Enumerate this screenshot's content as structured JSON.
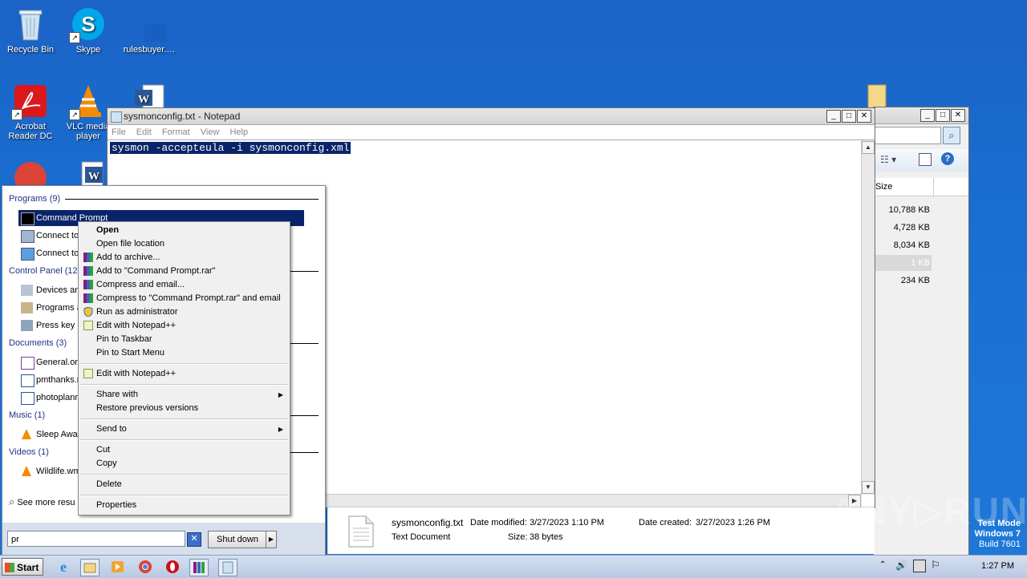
{
  "desktop_icons": [
    {
      "label": "Recycle Bin",
      "icon": "recycle-bin-icon"
    },
    {
      "label": "Skype",
      "icon": "skype-icon"
    },
    {
      "label": "rulesbuyer.…",
      "icon": "blank-file-icon"
    },
    {
      "label": "Acrobat Reader DC",
      "icon": "acrobat-icon"
    },
    {
      "label": "VLC media player",
      "icon": "vlc-icon"
    },
    {
      "label": "",
      "icon": "word-doc-icon"
    },
    {
      "label": "",
      "icon": "chrome-icon"
    },
    {
      "label": "",
      "icon": "word-doc-icon"
    },
    {
      "label": "",
      "icon": "folder-icon"
    }
  ],
  "notepad": {
    "title": "sysmonconfig.txt - Notepad",
    "menu": [
      "File",
      "Edit",
      "Format",
      "View",
      "Help"
    ],
    "content": "sysmon -accepteula -i sysmonconfig.xml",
    "buttons": {
      "minimize": "_",
      "maximize": "□",
      "close": "✕"
    }
  },
  "explorer": {
    "column_header": "Size",
    "sizes": [
      "10,788 KB",
      "4,728 KB",
      "8,034 KB",
      "1 KB",
      "234 KB"
    ],
    "buttons": {
      "minimize": "_",
      "maximize": "□",
      "close": "✕"
    },
    "details": {
      "name": "sysmonconfig.txt",
      "type": "Text Document",
      "modified_label": "Date modified:",
      "modified": "3/27/2023 1:10 PM",
      "created_label": "Date created:",
      "created": "3/27/2023 1:26 PM",
      "size_label": "Size:",
      "size": "38 bytes"
    }
  },
  "start_menu": {
    "groups": {
      "programs": "Programs (9)",
      "control_panel": "Control Panel (128)",
      "documents": "Documents (3)",
      "music": "Music (1)",
      "videos": "Videos (1)"
    },
    "programs": [
      "Command Prompt",
      "Connect to",
      "Connect to"
    ],
    "control_panel": [
      "Devices and",
      "Programs a",
      "Press key c"
    ],
    "documents": [
      "General.on",
      "pmthanks.r",
      "photoplann"
    ],
    "music": [
      "Sleep Away"
    ],
    "videos": [
      "Wildlife.wm"
    ],
    "see_more": "See more resu",
    "search_value": "pr",
    "clear": "✕",
    "shutdown": "Shut down",
    "shutdown_arrow": "▶"
  },
  "context_menu": {
    "items": [
      {
        "label": "Open",
        "bold": true
      },
      {
        "label": "Open file location"
      },
      {
        "label": "Add to archive...",
        "icon": "winrar-icon"
      },
      {
        "label": "Add to \"Command Prompt.rar\"",
        "icon": "winrar-icon"
      },
      {
        "label": "Compress and email...",
        "icon": "winrar-icon"
      },
      {
        "label": "Compress to \"Command Prompt.rar\" and email",
        "icon": "winrar-icon"
      },
      {
        "label": "Run as administrator",
        "icon": "shield-icon"
      },
      {
        "label": "Edit with Notepad++",
        "icon": "notepadpp-icon"
      },
      {
        "label": "Pin to Taskbar"
      },
      {
        "label": "Pin to Start Menu"
      },
      {
        "label": "Edit with Notepad++",
        "icon": "notepadpp-icon"
      },
      {
        "label": "Share with",
        "submenu": true
      },
      {
        "label": "Restore previous versions"
      },
      {
        "label": "Send to",
        "submenu": true
      },
      {
        "label": "Cut"
      },
      {
        "label": "Copy"
      },
      {
        "label": "Delete"
      },
      {
        "label": "Properties"
      }
    ]
  },
  "taskbar": {
    "start": "Start",
    "apps": [
      "ie-icon",
      "explorer-icon",
      "media-player-icon",
      "chrome-icon",
      "opera-icon",
      "winrar-icon",
      "notepad-icon"
    ],
    "clock": "1:27 PM"
  },
  "watermark": {
    "line1": "Test Mode",
    "line2": "Windows 7",
    "line3": "Build 7601",
    "anyrun": "ANY▷RUN"
  }
}
